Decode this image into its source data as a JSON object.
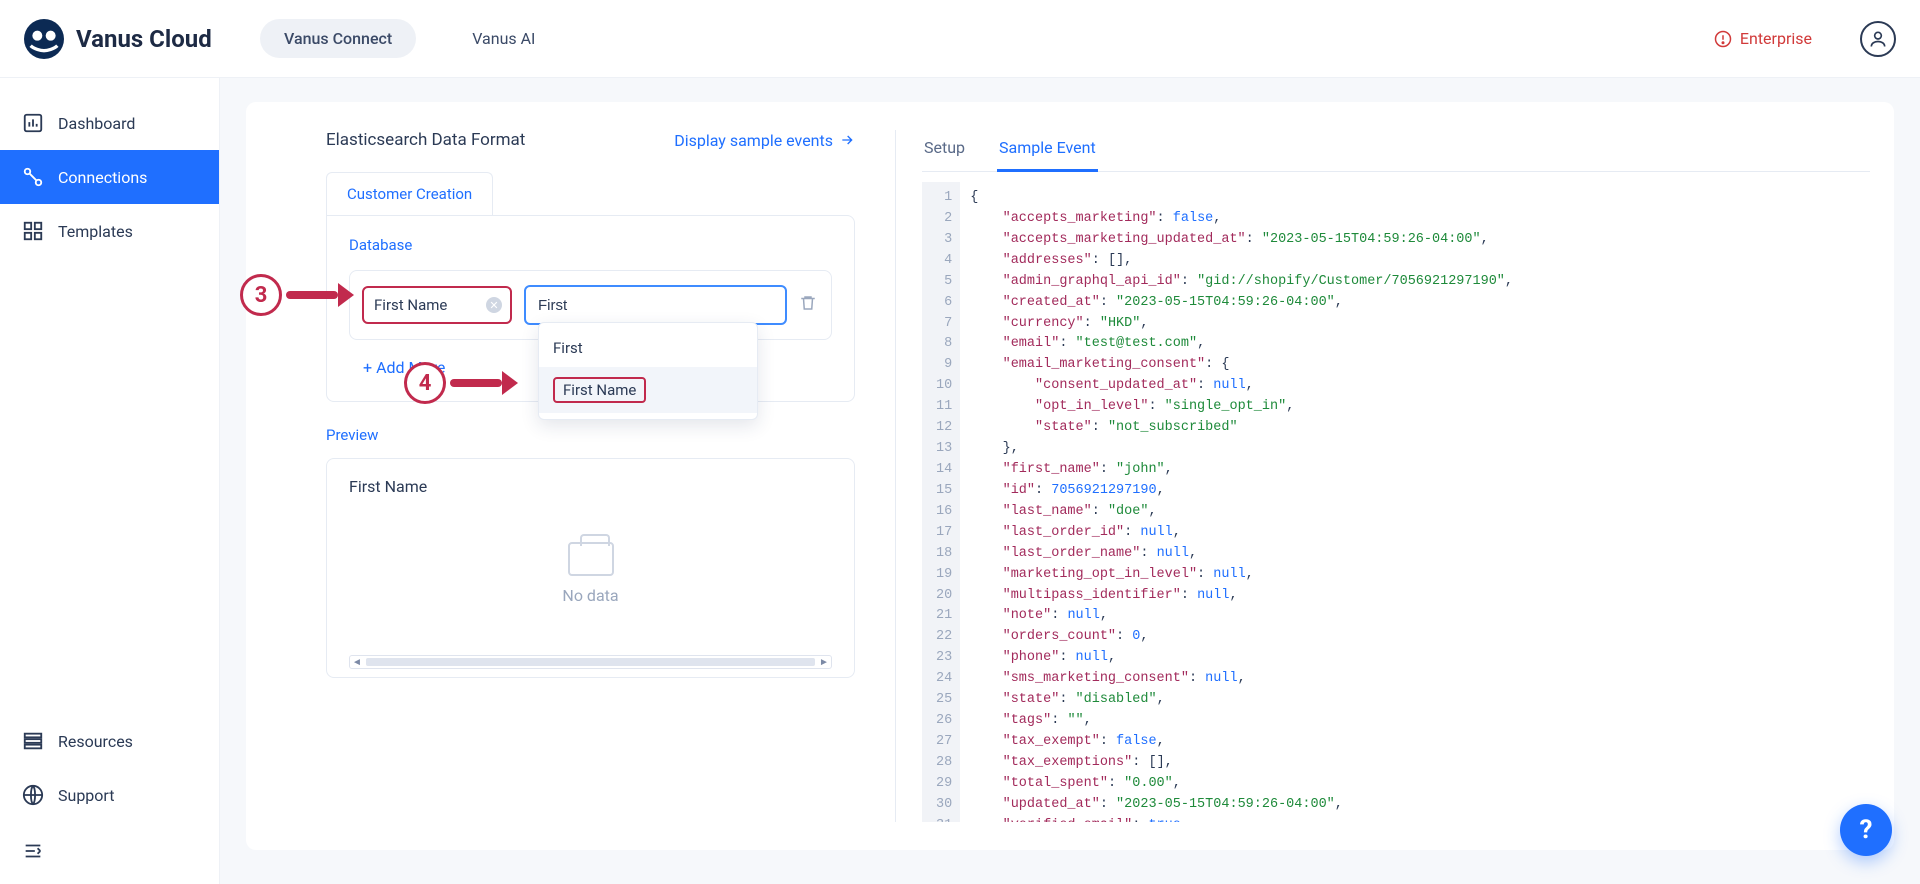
{
  "brand": {
    "name": "Vanus Cloud"
  },
  "top_nav": {
    "items": [
      "Vanus Connect",
      "Vanus AI"
    ],
    "active_index": 0,
    "enterprise_label": "Enterprise"
  },
  "sidebar": {
    "items": [
      {
        "label": "Dashboard",
        "icon": "dashboard-icon"
      },
      {
        "label": "Connections",
        "icon": "connections-icon"
      },
      {
        "label": "Templates",
        "icon": "templates-icon"
      }
    ],
    "active_index": 1,
    "footer": [
      {
        "label": "Resources",
        "icon": "resources-icon"
      },
      {
        "label": "Support",
        "icon": "support-icon"
      }
    ]
  },
  "left": {
    "title": "Elasticsearch Data Format",
    "sample_link": "Display sample events",
    "subtab": "Customer Creation",
    "db_label": "Database",
    "field_key_value": "First Name",
    "field_value_input": "First",
    "add_more": "Add More",
    "dropdown": {
      "option1": "First",
      "option2": "First Name"
    },
    "preview_label": "Preview",
    "preview_column": "First Name",
    "no_data": "No data"
  },
  "annotations": {
    "step3": "3",
    "step4": "4"
  },
  "right": {
    "tabs": [
      "Setup",
      "Sample Event"
    ],
    "active_index": 1,
    "json_event": {
      "accepts_marketing": false,
      "accepts_marketing_updated_at": "2023-05-15T04:59:26-04:00",
      "addresses": [],
      "admin_graphql_api_id": "gid://shopify/Customer/7056921297190",
      "created_at": "2023-05-15T04:59:26-04:00",
      "currency": "HKD",
      "email": "test@test.com",
      "email_marketing_consent": {
        "consent_updated_at": null,
        "opt_in_level": "single_opt_in",
        "state": "not_subscribed"
      },
      "first_name": "john",
      "id": 7056921297190,
      "last_name": "doe",
      "last_order_id": null,
      "last_order_name": null,
      "marketing_opt_in_level": null,
      "multipass_identifier": null,
      "note": null,
      "orders_count": 0,
      "phone": null,
      "sms_marketing_consent": null,
      "state": "disabled",
      "tags": "",
      "tax_exempt": false,
      "tax_exemptions": [],
      "total_spent": "0.00",
      "updated_at": "2023-05-15T04:59:26-04:00",
      "verified_email": true
    }
  },
  "colors": {
    "brand_blue": "#1f6fff",
    "annotation_red": "#c12a4d"
  }
}
